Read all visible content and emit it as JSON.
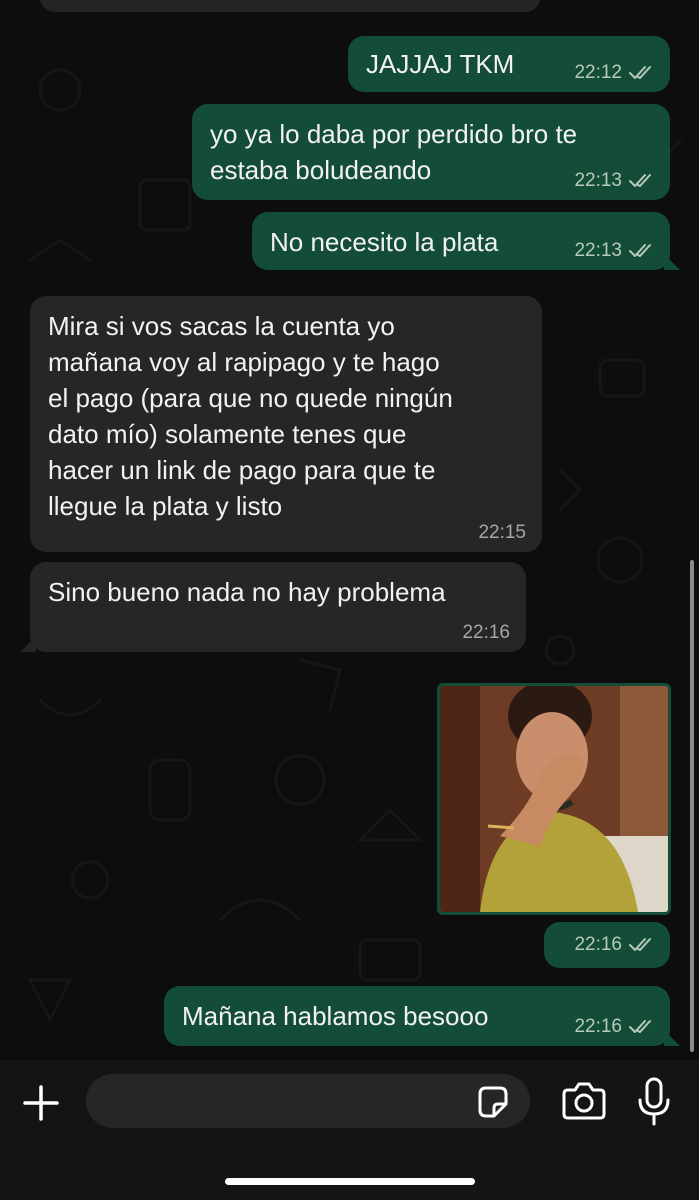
{
  "conversation": {
    "messages": [
      {
        "direction": "out",
        "text": "JAJJAJ TKM",
        "time": "22:12",
        "status": "read"
      },
      {
        "direction": "out",
        "text": "yo ya lo daba por perdido bro te\nestaba boludeando",
        "time": "22:13",
        "status": "read"
      },
      {
        "direction": "out",
        "text": "No necesito la plata",
        "time": "22:13",
        "status": "read"
      },
      {
        "direction": "in",
        "text": "Mira si vos sacas la cuenta yo\nmañana voy al rapipago y te hago\nel pago (para que no quede ningún\ndato mío) solamente tenes que\nhacer un link de pago para que te\nllegue la plata y listo",
        "time": "22:15"
      },
      {
        "direction": "in",
        "text": "Sino bueno nada no hay problema",
        "time": "22:16"
      },
      {
        "direction": "out",
        "type": "gif",
        "time": "22:16",
        "status": "read"
      },
      {
        "direction": "out",
        "text": "Mañana hablamos besooo",
        "time": "22:16",
        "status": "read"
      }
    ]
  },
  "composer": {
    "placeholder": ""
  },
  "icons": {
    "attach": "plus-icon",
    "sticker": "sticker-icon",
    "camera": "camera-icon",
    "mic": "microphone-icon",
    "read_receipt": "double-check-icon"
  },
  "colors": {
    "outgoing_bubble": "#144d37",
    "incoming_bubble": "#262626",
    "background": "#0d0d0d",
    "read_ticks": "#b6c9bf"
  }
}
